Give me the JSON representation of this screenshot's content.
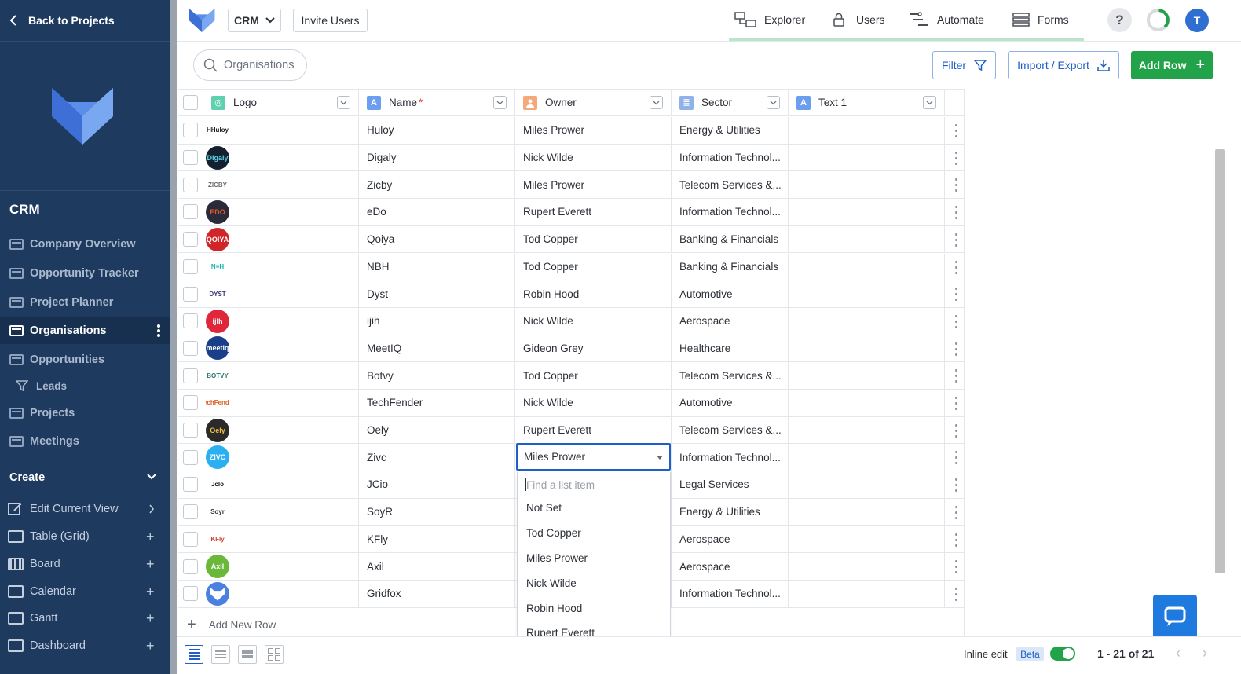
{
  "sidebar": {
    "back_label": "Back to Projects",
    "app_title": "CRM",
    "items": [
      {
        "label": "Company Overview",
        "active": false
      },
      {
        "label": "Opportunity Tracker",
        "active": false
      },
      {
        "label": "Project Planner",
        "active": false
      },
      {
        "label": "Organisations",
        "active": true
      },
      {
        "label": "Opportunities",
        "active": false
      },
      {
        "label": "Leads",
        "active": false,
        "sub": true
      },
      {
        "label": "Projects",
        "active": false
      },
      {
        "label": "Meetings",
        "active": false
      }
    ],
    "create_title": "Create",
    "create_items": [
      {
        "label": "Edit Current View"
      },
      {
        "label": "Table (Grid)"
      },
      {
        "label": "Board"
      },
      {
        "label": "Calendar"
      },
      {
        "label": "Gantt"
      },
      {
        "label": "Dashboard"
      }
    ]
  },
  "topbar": {
    "project_select": "CRM",
    "invite_label": "Invite Users",
    "nav": [
      {
        "label": "Explorer",
        "icon": "explorer-icon"
      },
      {
        "label": "Users",
        "icon": "lock-icon"
      },
      {
        "label": "Automate",
        "icon": "automate-icon"
      },
      {
        "label": "Forms",
        "icon": "forms-icon"
      }
    ],
    "help": "?",
    "avatar_initial": "T"
  },
  "toolbar": {
    "search_placeholder": "Organisations",
    "filter_label": "Filter",
    "import_export_label": "Import / Export",
    "add_row_label": "Add Row"
  },
  "columns": [
    {
      "label": "Logo",
      "type_color": "#5fd0b0",
      "type_glyph": "◎"
    },
    {
      "label": "Name",
      "required": "*",
      "type_color": "#6c9ef0",
      "type_glyph": "A"
    },
    {
      "label": "Owner",
      "type_color": "#f4a97a",
      "type_glyph": "👤"
    },
    {
      "label": "Sector",
      "type_color": "#8fb2e8",
      "type_glyph": "≣"
    },
    {
      "label": "Text 1",
      "type_color": "#6c9ef0",
      "type_glyph": "A"
    }
  ],
  "rows": [
    {
      "logo_text": "HHuloy",
      "logo_bg": "",
      "logo_fg": "#1b1b1b",
      "name": "Huloy",
      "owner": "Miles Prower",
      "sector": "Energy & Utilities"
    },
    {
      "logo_text": "Digaly",
      "logo_bg": "#14202f",
      "logo_fg": "#5ad0e0",
      "name": "Digaly",
      "owner": "Nick Wilde",
      "sector": "Information Technol..."
    },
    {
      "logo_text": "ZICBY",
      "logo_bg": "",
      "logo_fg": "#6b6b6b",
      "name": "Zicby",
      "owner": "Miles Prower",
      "sector": "Telecom Services &..."
    },
    {
      "logo_text": "EDO",
      "logo_bg": "#2a2a3a",
      "logo_fg": "#e05a2a",
      "name": "eDo",
      "owner": "Rupert Everett",
      "sector": "Information Technol..."
    },
    {
      "logo_text": "QOIYA",
      "logo_bg": "#d0262a",
      "logo_fg": "#ffffff",
      "name": "Qoiya",
      "owner": "Tod Copper",
      "sector": "Banking & Financials"
    },
    {
      "logo_text": "N≡H",
      "logo_bg": "",
      "logo_fg": "#19b3a8",
      "name": "NBH",
      "owner": "Tod Copper",
      "sector": "Banking & Financials"
    },
    {
      "logo_text": "DYST",
      "logo_bg": "",
      "logo_fg": "#3a3a7a",
      "name": "Dyst",
      "owner": "Robin Hood",
      "sector": "Automotive"
    },
    {
      "logo_text": "ijlh",
      "logo_bg": "#e0263a",
      "logo_fg": "#ffffff",
      "name": "ijih",
      "owner": "Nick Wilde",
      "sector": "Aerospace"
    },
    {
      "logo_text": "meetiq",
      "logo_bg": "#1a3f8a",
      "logo_fg": "#ffffff",
      "name": "MeetIQ",
      "owner": "Gideon Grey",
      "sector": "Healthcare"
    },
    {
      "logo_text": "BOTVY",
      "logo_bg": "",
      "logo_fg": "#2a7a6a",
      "name": "Botvy",
      "owner": "Tod Copper",
      "sector": "Telecom Services &..."
    },
    {
      "logo_text": "TechFender",
      "logo_bg": "",
      "logo_fg": "#e05a1a",
      "name": "TechFender",
      "owner": "Nick Wilde",
      "sector": "Automotive"
    },
    {
      "logo_text": "Oely",
      "logo_bg": "#2a2a2a",
      "logo_fg": "#f0c040",
      "name": "Oely",
      "owner": "Rupert Everett",
      "sector": "Telecom Services &..."
    },
    {
      "logo_text": "ZIVC",
      "logo_bg": "#2ab0f0",
      "logo_fg": "#ffffff",
      "name": "Zivc",
      "owner": "Miles Prower",
      "sector": "Information Technol...",
      "editing": true
    },
    {
      "logo_text": "Jclo",
      "logo_bg": "",
      "logo_fg": "#111111",
      "name": "JCio",
      "owner": "",
      "sector": "Legal Services"
    },
    {
      "logo_text": "Soyr",
      "logo_bg": "",
      "logo_fg": "#333333",
      "name": "SoyR",
      "owner": "",
      "sector": "Energy & Utilities"
    },
    {
      "logo_text": "KFly",
      "logo_bg": "",
      "logo_fg": "#d0402a",
      "name": "KFly",
      "owner": "",
      "sector": "Aerospace"
    },
    {
      "logo_text": "Axil",
      "logo_bg": "#6ab83a",
      "logo_fg": "#ffffff",
      "name": "Axil",
      "owner": "",
      "sector": "Aerospace"
    },
    {
      "logo_text": "",
      "logo_bg": "#4a80e0",
      "logo_fg": "#ffffff",
      "name": "Gridfox",
      "owner": "",
      "sector": "Information Technol..."
    }
  ],
  "dropdown": {
    "search_placeholder": "Find a list item",
    "options": [
      "Not Set",
      "Tod Copper",
      "Miles Prower",
      "Nick Wilde",
      "Robin Hood",
      "Rupert Everett"
    ]
  },
  "add_new_row_label": "Add New Row",
  "footer": {
    "inline_edit_label": "Inline edit",
    "beta_label": "Beta",
    "pager_label": "1 - 21 of 21"
  },
  "colors": {
    "sidebar_bg": "#1e3a5f",
    "accent_blue": "#1f5fc7",
    "add_green": "#22a34a"
  }
}
